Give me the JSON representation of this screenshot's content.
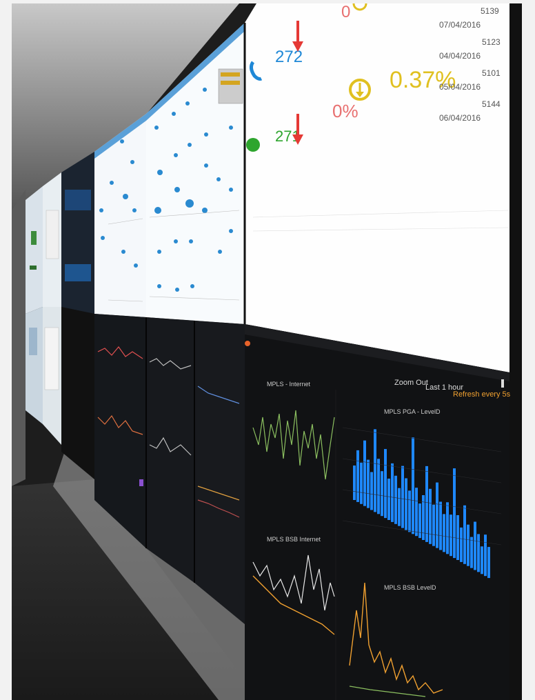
{
  "photo": {
    "kpi": {
      "calls_value": "272",
      "chat_value": "271",
      "percent_zero": "0%",
      "percent_main": "0.37%"
    },
    "dates": [
      {
        "date": "07/04/2016",
        "value": "5139"
      },
      {
        "date": "04/04/2016",
        "value": "5123"
      },
      {
        "date": "05/04/2016",
        "value": "5101"
      },
      {
        "date": "06/04/2016",
        "value": "5144"
      }
    ],
    "grafana": {
      "zoom_out": "Zoom Out",
      "time_range": "Last 1 hour",
      "refresh": "Refresh every 5s",
      "panel_top_title": "MPLS PGA - LevelD",
      "panel_bottom_title": "MPLS BSB LevelD",
      "panel_left_title": "MPLS - Internet",
      "panel_left_bottom_title": "MPLS BSB Internet"
    },
    "colors": {
      "blue_bars": "#1e88ff",
      "kpi_blue": "#1f88d6",
      "kpi_green": "#2ea52e",
      "kpi_red": "#e53935",
      "kpi_yellow": "#e0c020",
      "orange_line": "#f0a030",
      "green_line": "#8cc060"
    }
  }
}
